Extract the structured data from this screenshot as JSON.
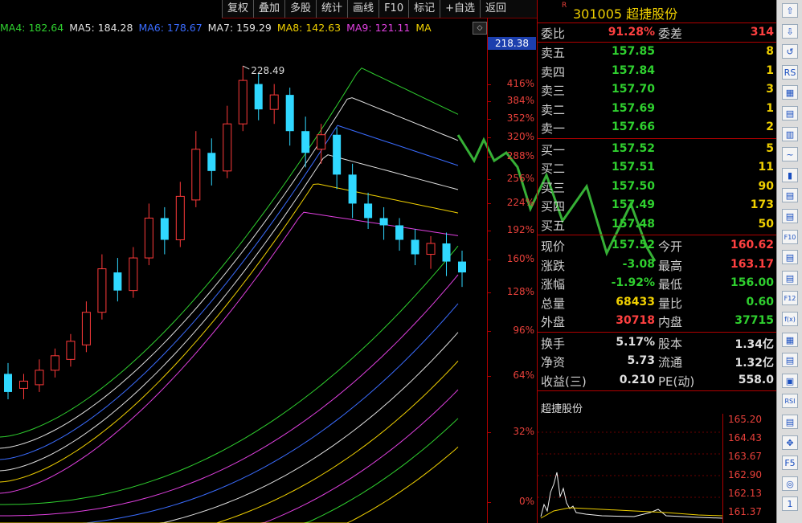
{
  "toolbar": [
    "复权",
    "叠加",
    "多股",
    "统计",
    "画线",
    "F10",
    "标记",
    "+自选",
    "返回"
  ],
  "ma_legend": [
    {
      "label": "MA4: 182.64",
      "color": "#2fd02f"
    },
    {
      "label": "MA5: 184.28",
      "color": "#e0e0e0"
    },
    {
      "label": "MA6: 178.67",
      "color": "#3a6cff"
    },
    {
      "label": "MA7: 159.29",
      "color": "#e0e0e0"
    },
    {
      "label": "MA8: 142.63",
      "color": "#f0d000"
    },
    {
      "label": "MA9: 121.11",
      "color": "#e040e0"
    },
    {
      "label": "MA",
      "color": "#f0d000"
    }
  ],
  "chart_data": {
    "type": "candlestick",
    "high_label": "228.49",
    "current_price_label": "218.38",
    "y_ticks": [
      "416%",
      "384%",
      "352%",
      "320%",
      "288%",
      "256%",
      "224%",
      "192%",
      "160%",
      "128%",
      "96%",
      "64%",
      "32%",
      "0%"
    ],
    "candles": [
      [
        143,
        138,
        146,
        136
      ],
      [
        139,
        141,
        143,
        136
      ],
      [
        140,
        144,
        147,
        138
      ],
      [
        144,
        148,
        150,
        142
      ],
      [
        147,
        152,
        154,
        145
      ],
      [
        151,
        160,
        163,
        149
      ],
      [
        160,
        172,
        176,
        158
      ],
      [
        171,
        166,
        175,
        163
      ],
      [
        166,
        175,
        178,
        164
      ],
      [
        175,
        186,
        190,
        173
      ],
      [
        186,
        180,
        189,
        176
      ],
      [
        180,
        192,
        196,
        178
      ],
      [
        191,
        205,
        210,
        189
      ],
      [
        204,
        199,
        208,
        195
      ],
      [
        199,
        212,
        217,
        197
      ],
      [
        212,
        224,
        228,
        210
      ],
      [
        223,
        216,
        226,
        213
      ],
      [
        216,
        220,
        223,
        212
      ],
      [
        220,
        210,
        222,
        206
      ],
      [
        210,
        204,
        214,
        200
      ],
      [
        205,
        209,
        212,
        201
      ],
      [
        209,
        198,
        211,
        194
      ],
      [
        198,
        190,
        201,
        186
      ],
      [
        190,
        186,
        193,
        183
      ],
      [
        186,
        184,
        189,
        180
      ],
      [
        184,
        180,
        186,
        177
      ],
      [
        180,
        176,
        183,
        173
      ],
      [
        176,
        179,
        181,
        172
      ],
      [
        179,
        174,
        182,
        170
      ],
      [
        174,
        171,
        177,
        167
      ]
    ],
    "ma_lines_visible": 14
  },
  "quote": {
    "badge": "R",
    "title": "301005 超捷股份",
    "wei": {
      "label": "委比",
      "value": "91.28%",
      "label2": "委差",
      "value2": "314"
    },
    "asks": [
      {
        "label": "卖五",
        "price": "157.85",
        "vol": "8"
      },
      {
        "label": "卖四",
        "price": "157.84",
        "vol": "1"
      },
      {
        "label": "卖三",
        "price": "157.70",
        "vol": "3"
      },
      {
        "label": "卖二",
        "price": "157.69",
        "vol": "1"
      },
      {
        "label": "卖一",
        "price": "157.66",
        "vol": "2"
      }
    ],
    "bids": [
      {
        "label": "买一",
        "price": "157.52",
        "vol": "5"
      },
      {
        "label": "买二",
        "price": "157.51",
        "vol": "11"
      },
      {
        "label": "买三",
        "price": "157.50",
        "vol": "90"
      },
      {
        "label": "买四",
        "price": "157.49",
        "vol": "173"
      },
      {
        "label": "买五",
        "price": "157.48",
        "vol": "50"
      }
    ],
    "stats": [
      {
        "l": "现价",
        "v": "157.52",
        "vc": "g",
        "l2": "今开",
        "v2": "160.62",
        "v2c": "r"
      },
      {
        "l": "涨跌",
        "v": "-3.08",
        "vc": "g",
        "l2": "最高",
        "v2": "163.17",
        "v2c": "r"
      },
      {
        "l": "涨幅",
        "v": "-1.92%",
        "vc": "g",
        "l2": "最低",
        "v2": "156.00",
        "v2c": "g"
      },
      {
        "l": "总量",
        "v": "68433",
        "vc": "y",
        "l2": "量比",
        "v2": "0.60",
        "v2c": "g"
      },
      {
        "l": "外盘",
        "v": "30718",
        "vc": "r",
        "l2": "内盘",
        "v2": "37715",
        "v2c": "g"
      }
    ],
    "stats2": [
      {
        "l": "换手",
        "v": "5.17%",
        "vc": "w",
        "l2": "股本",
        "v2": "1.34亿",
        "v2c": "w"
      },
      {
        "l": "净资",
        "v": "5.73",
        "vc": "w",
        "l2": "流通",
        "v2": "1.32亿",
        "v2c": "w"
      },
      {
        "l": "收益(三)",
        "v": "0.210",
        "vc": "w",
        "l2": "PE(动)",
        "v2": "558.0",
        "v2c": "w"
      }
    ],
    "mini_title": "超捷股份",
    "mini_ticks": [
      "165.20",
      "164.43",
      "163.67",
      "162.90",
      "162.13",
      "161.37"
    ]
  },
  "side_icons": [
    "⇧",
    "⇩",
    "↺",
    "RS",
    "▦",
    "▤",
    "▥",
    "~",
    "▮",
    "▤",
    "▤",
    "F10",
    "▤",
    "▤",
    "F12",
    "f(x)",
    "▦",
    "▤",
    "▣",
    "RSI",
    "▤",
    "✥",
    "F5",
    "◎",
    "1"
  ]
}
